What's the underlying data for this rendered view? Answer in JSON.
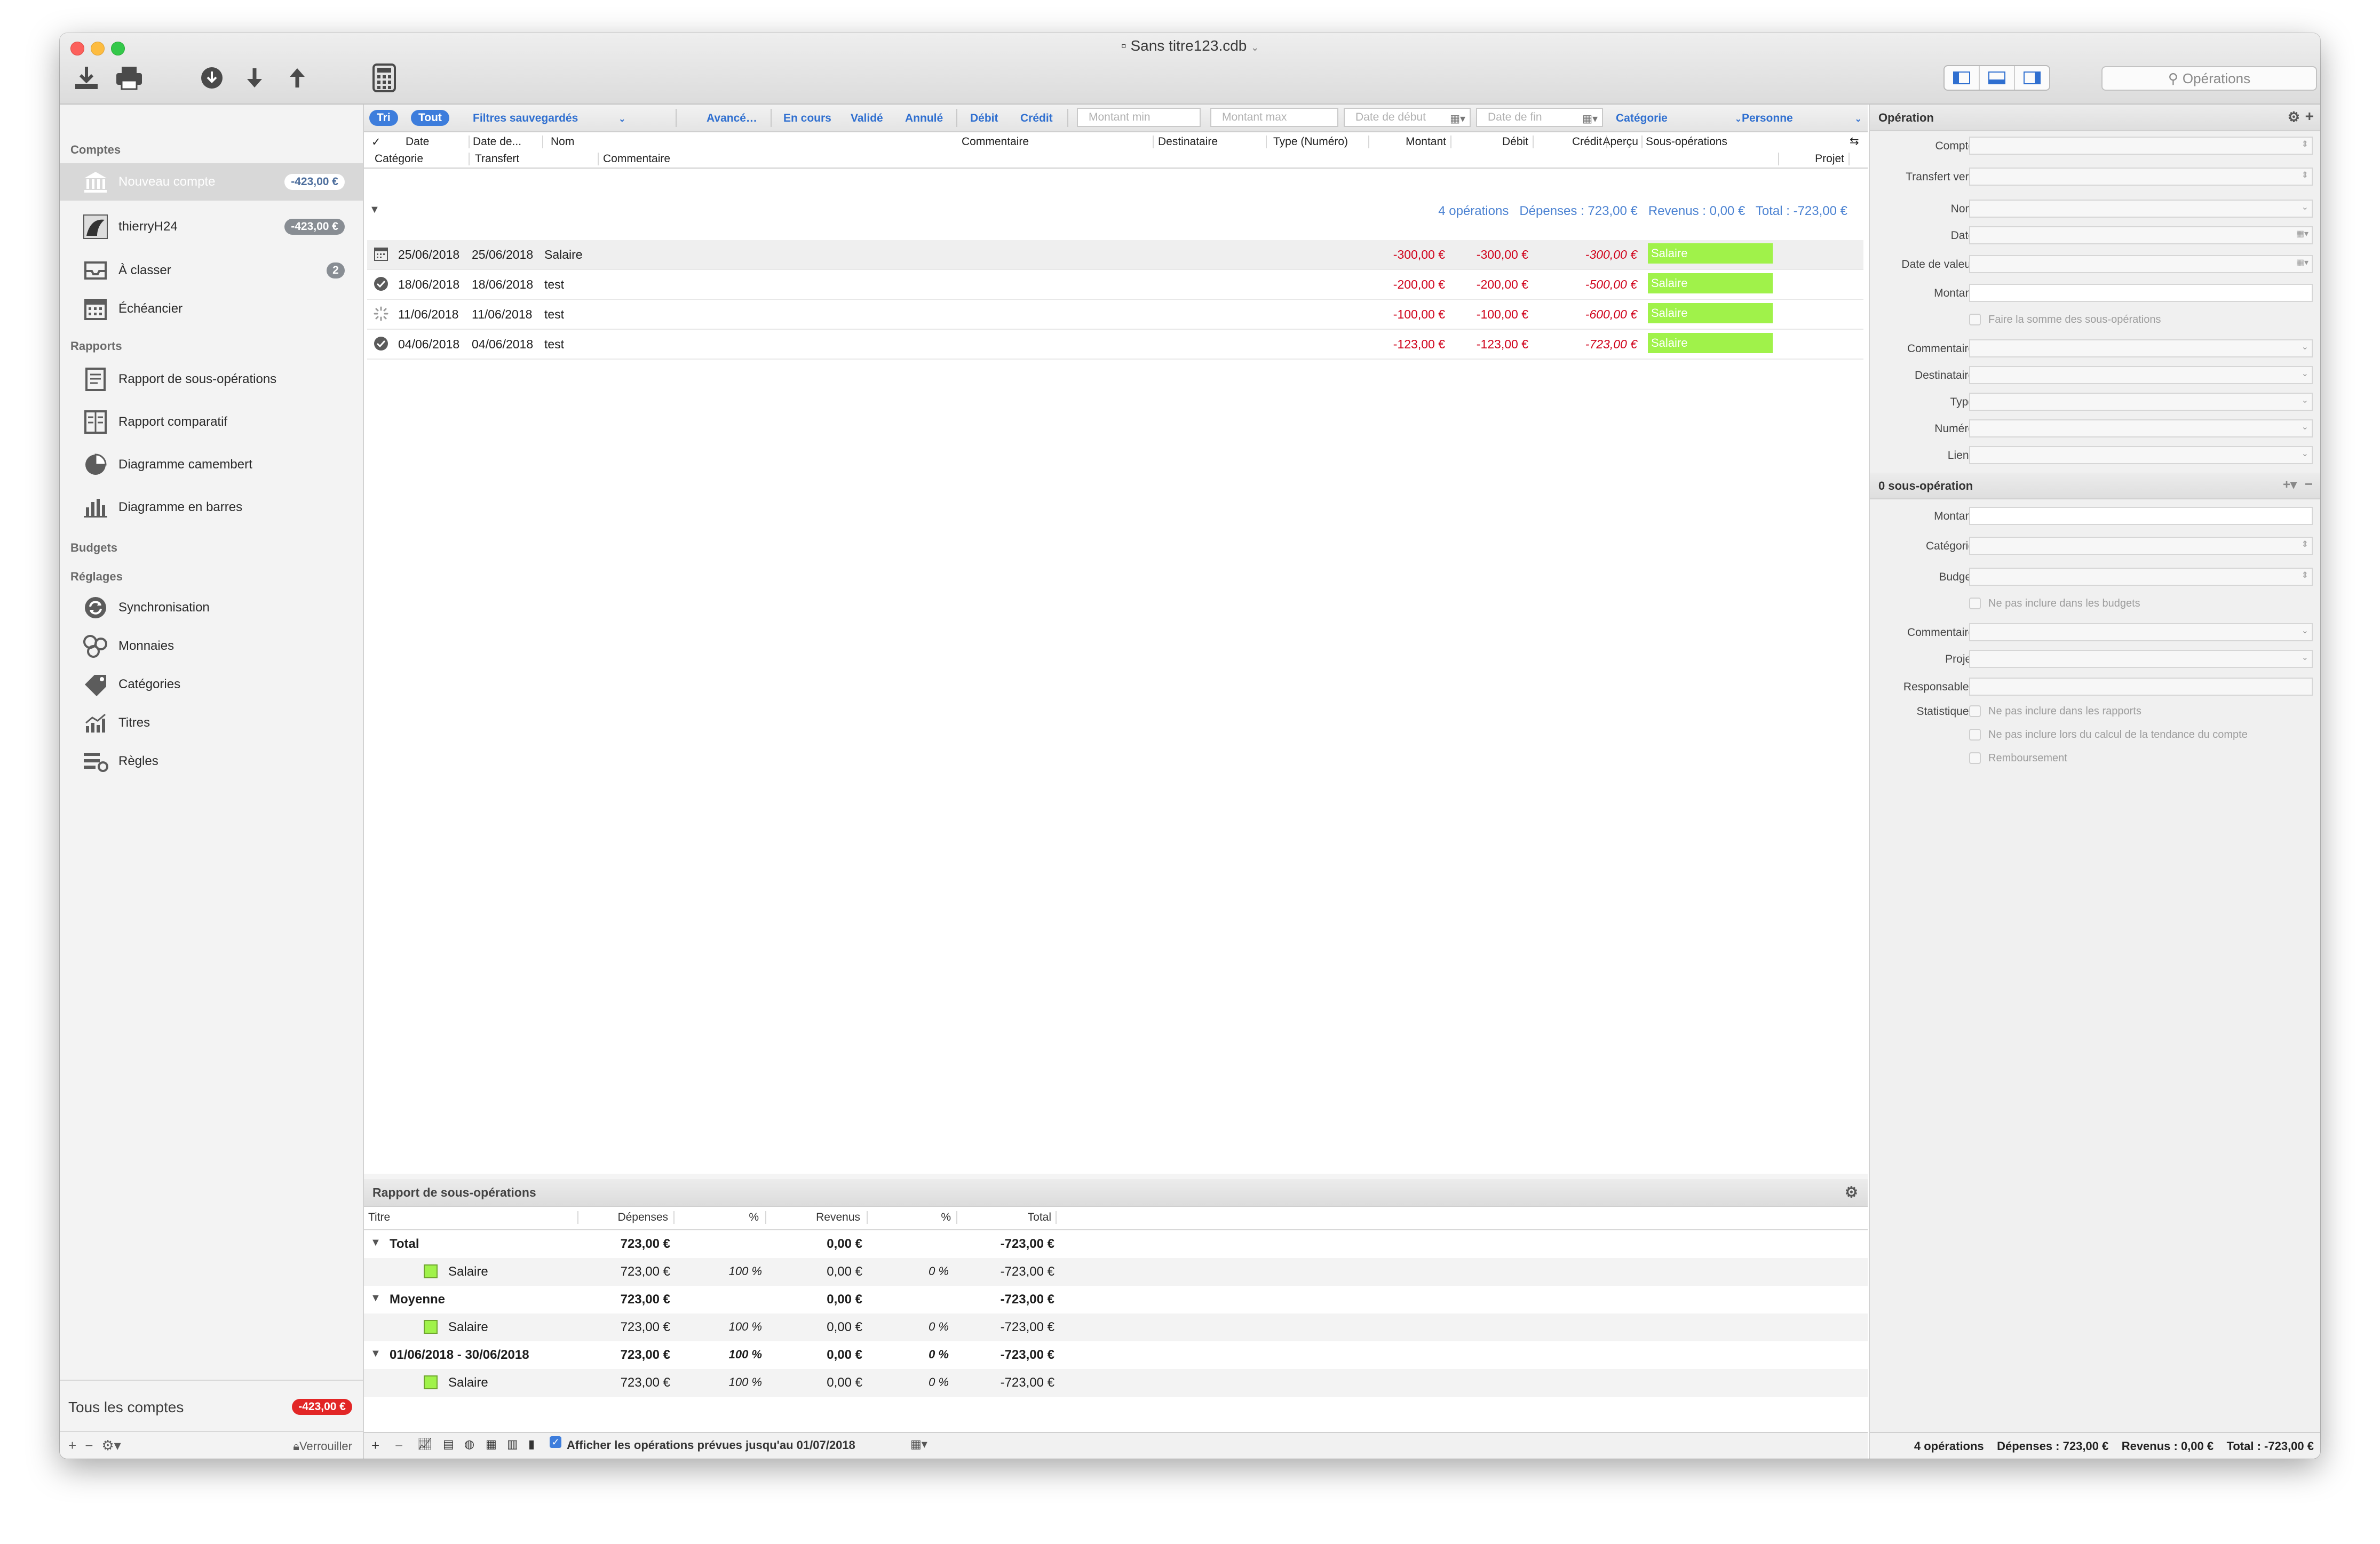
{
  "window": {
    "title": "Sans titre123.cdb"
  },
  "toolbar": {
    "search_placeholder": "Opérations"
  },
  "sidebar": {
    "accounts_header": "Comptes",
    "accounts": [
      {
        "label": "Nouveau compte",
        "amount": "-423,00 €"
      },
      {
        "label": "thierryH24",
        "amount": "-423,00 €"
      },
      {
        "label": "À classer",
        "count": "2"
      },
      {
        "label": "Échéancier"
      }
    ],
    "reports_header": "Rapports",
    "reports": [
      {
        "label": "Rapport de sous-opérations"
      },
      {
        "label": "Rapport comparatif"
      },
      {
        "label": "Diagramme camembert"
      },
      {
        "label": "Diagramme en barres"
      }
    ],
    "budgets_header": "Budgets",
    "settings_header": "Réglages",
    "settings": [
      {
        "label": "Synchronisation"
      },
      {
        "label": "Monnaies"
      },
      {
        "label": "Catégories"
      },
      {
        "label": "Titres"
      },
      {
        "label": "Règles"
      }
    ],
    "all_accounts": "Tous les comptes",
    "all_amount": "-423,00 €",
    "lock_label": "Verrouiller"
  },
  "filters": {
    "tri": "Tri",
    "tout": "Tout",
    "saved": "Filtres sauvegardés",
    "advanced": "Avancé…",
    "en_cours": "En cours",
    "valide": "Validé",
    "annule": "Annulé",
    "debit": "Débit",
    "credit": "Crédit",
    "min_placeholder": "Montant min",
    "max_placeholder": "Montant max",
    "start_placeholder": "Date de début",
    "end_placeholder": "Date de fin",
    "category": "Catégorie",
    "person": "Personne"
  },
  "columns": {
    "check": "✓",
    "date": "Date",
    "date_value": "Date de...",
    "name": "Nom",
    "comment1": "Commentaire",
    "destinataire": "Destinataire",
    "type": "Type (Numéro)",
    "montant": "Montant",
    "debit": "Débit",
    "credit": "Crédit",
    "apercu": "Aperçu",
    "sous_ops": "Sous-opérations",
    "categorie": "Catégorie",
    "transfert": "Transfert",
    "comment2": "Commentaire",
    "projet": "Projet",
    "montant2": "Montant"
  },
  "summary": {
    "count": "4 opérations",
    "depenses": "Dépenses : 723,00 €",
    "revenus": "Revenus : 0,00 €",
    "total": "Total : -723,00 €"
  },
  "operations": [
    {
      "date": "25/06/2018",
      "date_value": "25/06/2018",
      "name": "Salaire",
      "montant": "-300,00 €",
      "debit": "-300,00 €",
      "apercu": "-300,00 €",
      "sub": "Salaire",
      "status": "scheduled"
    },
    {
      "date": "18/06/2018",
      "date_value": "18/06/2018",
      "name": "test",
      "montant": "-200,00 €",
      "debit": "-200,00 €",
      "apercu": "-500,00 €",
      "sub": "Salaire",
      "status": "validated"
    },
    {
      "date": "11/06/2018",
      "date_value": "11/06/2018",
      "name": "test",
      "montant": "-100,00 €",
      "debit": "-100,00 €",
      "apercu": "-600,00 €",
      "sub": "Salaire",
      "status": "pending"
    },
    {
      "date": "04/06/2018",
      "date_value": "04/06/2018",
      "name": "test",
      "montant": "-123,00 €",
      "debit": "-123,00 €",
      "apercu": "-723,00 €",
      "sub": "Salaire",
      "status": "validated"
    }
  ],
  "report": {
    "title": "Rapport de sous-opérations",
    "columns": [
      "Titre",
      "Dépenses",
      "%",
      "Revenus",
      "%",
      "Total"
    ],
    "rows": [
      {
        "title": "Total",
        "dep": "723,00 €",
        "pct1": "",
        "rev": "0,00 €",
        "pct2": "",
        "total": "-723,00 €",
        "group": true
      },
      {
        "title": "Salaire",
        "dep": "723,00 €",
        "pct1": "100 %",
        "rev": "0,00 €",
        "pct2": "0 %",
        "total": "-723,00 €",
        "group": false
      },
      {
        "title": "Moyenne",
        "dep": "723,00 €",
        "pct1": "",
        "rev": "0,00 €",
        "pct2": "",
        "total": "-723,00 €",
        "group": true
      },
      {
        "title": "Salaire",
        "dep": "723,00 €",
        "pct1": "100 %",
        "rev": "0,00 €",
        "pct2": "0 %",
        "total": "-723,00 €",
        "group": false
      },
      {
        "title": "01/06/2018 - 30/06/2018",
        "dep": "723,00 €",
        "pct1": "100 %",
        "rev": "0,00 €",
        "pct2": "0 %",
        "total": "-723,00 €",
        "group": true
      },
      {
        "title": "Salaire",
        "dep": "723,00 €",
        "pct1": "100 %",
        "rev": "0,00 €",
        "pct2": "0 %",
        "total": "-723,00 €",
        "group": false
      }
    ]
  },
  "bottom": {
    "show_planned": "Afficher les opérations prévues jusqu'au 01/07/2018",
    "status": "4 opérations    Dépenses : 723,00 €    Revenus : 0,00 €    Total : -723,00 €"
  },
  "inspector": {
    "title": "Opération",
    "fields": {
      "compte": "Compte",
      "transfert": "Transfert vers",
      "nom": "Nom",
      "date": "Date",
      "date_valeur": "Date de valeur",
      "montant": "Montant",
      "sum_sub": "Faire la somme des sous-opérations",
      "commentaire": "Commentaire",
      "destinataire": "Destinataire",
      "type": "Type",
      "numero": "Numéro",
      "liens": "Liens"
    },
    "sub_title": "0 sous-opération",
    "sub_fields": {
      "montant": "Montant",
      "categorie": "Catégorie",
      "budget": "Budget",
      "no_budget": "Ne pas inclure dans les budgets",
      "commentaire": "Commentaire",
      "projet": "Projet",
      "responsables": "Responsables",
      "statistiques": "Statistiques",
      "no_reports": "Ne pas inclure dans les rapports",
      "no_trend": "Ne pas inclure lors du calcul de la tendance du compte",
      "remboursement": "Remboursement"
    }
  }
}
